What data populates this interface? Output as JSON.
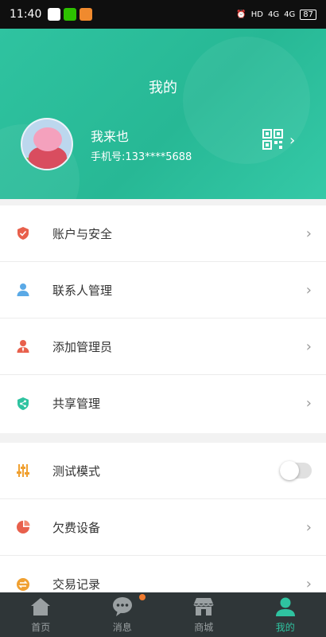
{
  "status_bar": {
    "time": "11:40",
    "signal_1": "4G",
    "signal_2": "4G",
    "hd": "HD",
    "battery": "87"
  },
  "header": {
    "title": "我的",
    "user_name": "我来也",
    "phone": "手机号:133****5688"
  },
  "menu_group_1": [
    {
      "label": "账户与安全",
      "icon": "shield-icon",
      "color": "#e8604c"
    },
    {
      "label": "联系人管理",
      "icon": "person-icon",
      "color": "#5aa9e6"
    },
    {
      "label": "添加管理员",
      "icon": "admin-icon",
      "color": "#e8604c"
    },
    {
      "label": "共享管理",
      "icon": "share-shield-icon",
      "color": "#2fc3a0"
    }
  ],
  "menu_group_2": [
    {
      "label": "测试模式",
      "icon": "sliders-icon",
      "color": "#f0a030",
      "toggle": false
    },
    {
      "label": "欠费设备",
      "icon": "pie-icon",
      "color": "#e8604c"
    },
    {
      "label": "交易记录",
      "icon": "exchange-icon",
      "color": "#f0a030"
    }
  ],
  "tabs": [
    {
      "label": "首页",
      "icon": "home-icon",
      "active": false
    },
    {
      "label": "消息",
      "icon": "chat-icon",
      "active": false,
      "badge": true
    },
    {
      "label": "商城",
      "icon": "store-icon",
      "active": false
    },
    {
      "label": "我的",
      "icon": "user-icon",
      "active": true
    }
  ],
  "colors": {
    "accent": "#2fc3a0",
    "tab_bar_bg": "#2f3638",
    "badge": "#f07a2e"
  }
}
